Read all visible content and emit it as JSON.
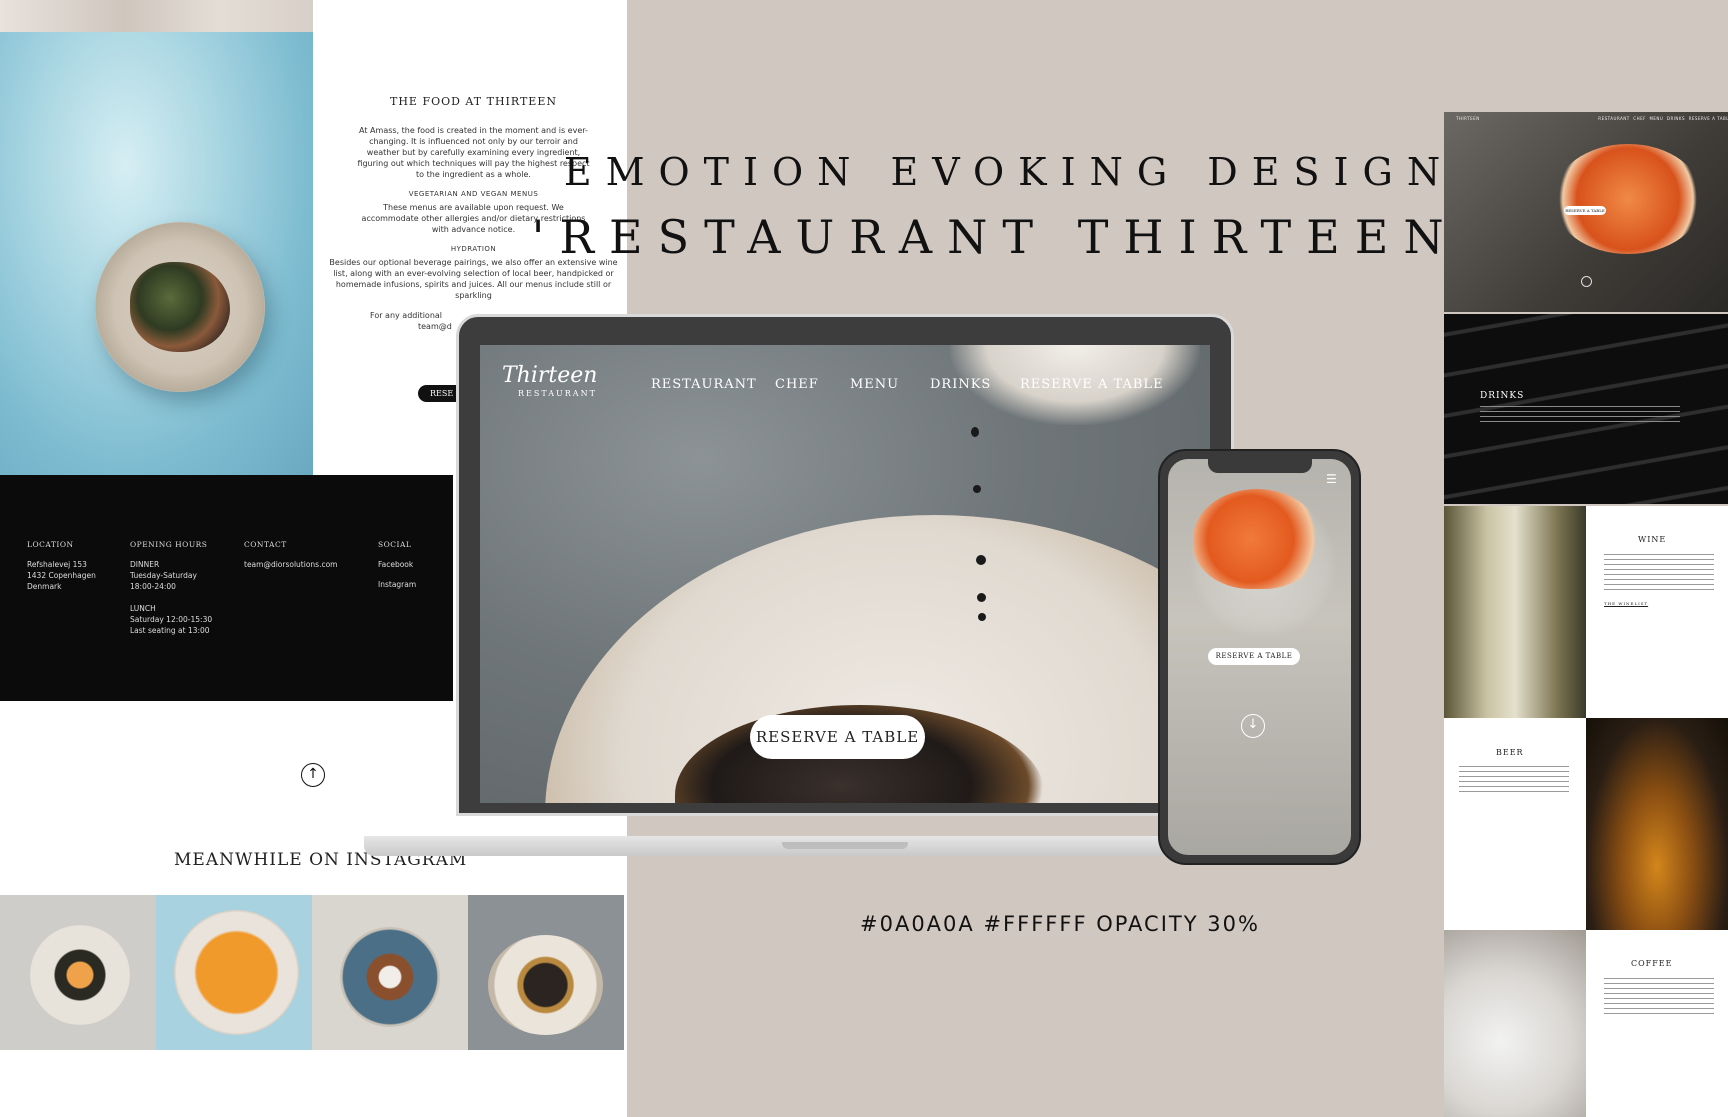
{
  "headline": {
    "line1": "EMOTION EVOKING DESIGN",
    "line2": "'RESTAURANT THIRTEEN'"
  },
  "color_note": "#0A0A0A #FFFFFF OPACITY 30%",
  "colors": {
    "background": "#d0c7c1",
    "dark": "#0a0a0a",
    "white": "#ffffff"
  },
  "food_section": {
    "title": "THE FOOD AT THIRTEEN",
    "intro": "At Amass, the food is created in the moment and is ever-changing. It is influenced not only by our terroir and weather but by carefully examining every ingredient, figuring out which techniques will pay the highest respect to the ingredient as a whole.",
    "veg_title": "VEGETARIAN AND VEGAN MENUS",
    "veg_text": "These menus are available upon request. We accommodate other allergies and/or dietary restrictions with advance notice.",
    "hydration_title": "HYDRATION",
    "hydration_text": "Besides our optional beverage pairings, we also offer an extensive wine list, along with an ever-evolving selection of local beer, handpicked or homemade infusions, spirits and juices. All our menus include still or sparkling",
    "contact_text": "For any additional",
    "contact_email_partial": "team@d",
    "reserve_partial": "RESE"
  },
  "footer": {
    "location_title": "LOCATION",
    "location_lines": [
      "Refshalevej 153",
      "1432 Copenhagen",
      "Denmark"
    ],
    "hours_title": "OPENING HOURS",
    "hours_lines": [
      "DINNER",
      "Tuesday-Saturday",
      "18:00-24:00",
      "",
      "LUNCH",
      "Saturday 12:00-15:30",
      "Last seating at 13:00"
    ],
    "contact_title": "CONTACT",
    "contact_email": "team@diorsolutions.com",
    "social_title": "SOCIAL",
    "social_links": [
      "Facebook",
      "Instagram"
    ]
  },
  "instagram_title": "MEANWHILE ON INSTAGRAM",
  "laptop": {
    "logo": "Thirteen",
    "logo_sub": "RESTAURANT",
    "nav": [
      "RESTAURANT",
      "CHEF",
      "MENU",
      "DRINKS",
      "RESERVE A TABLE"
    ],
    "cta": "RESERVE A TABLE"
  },
  "phone": {
    "menu_icon": "hamburger-menu-icon",
    "cta": "RESERVE A TABLE",
    "scroll_icon": "arrow-down-circle-icon"
  },
  "right_column": {
    "hero_cta": "RESERVE A TABLE",
    "drinks_label": "DRINKS",
    "wine_title": "WINE",
    "wine_link": "THE WINELIST",
    "beer_title": "BEER",
    "coffee_title": "COFFEE"
  }
}
